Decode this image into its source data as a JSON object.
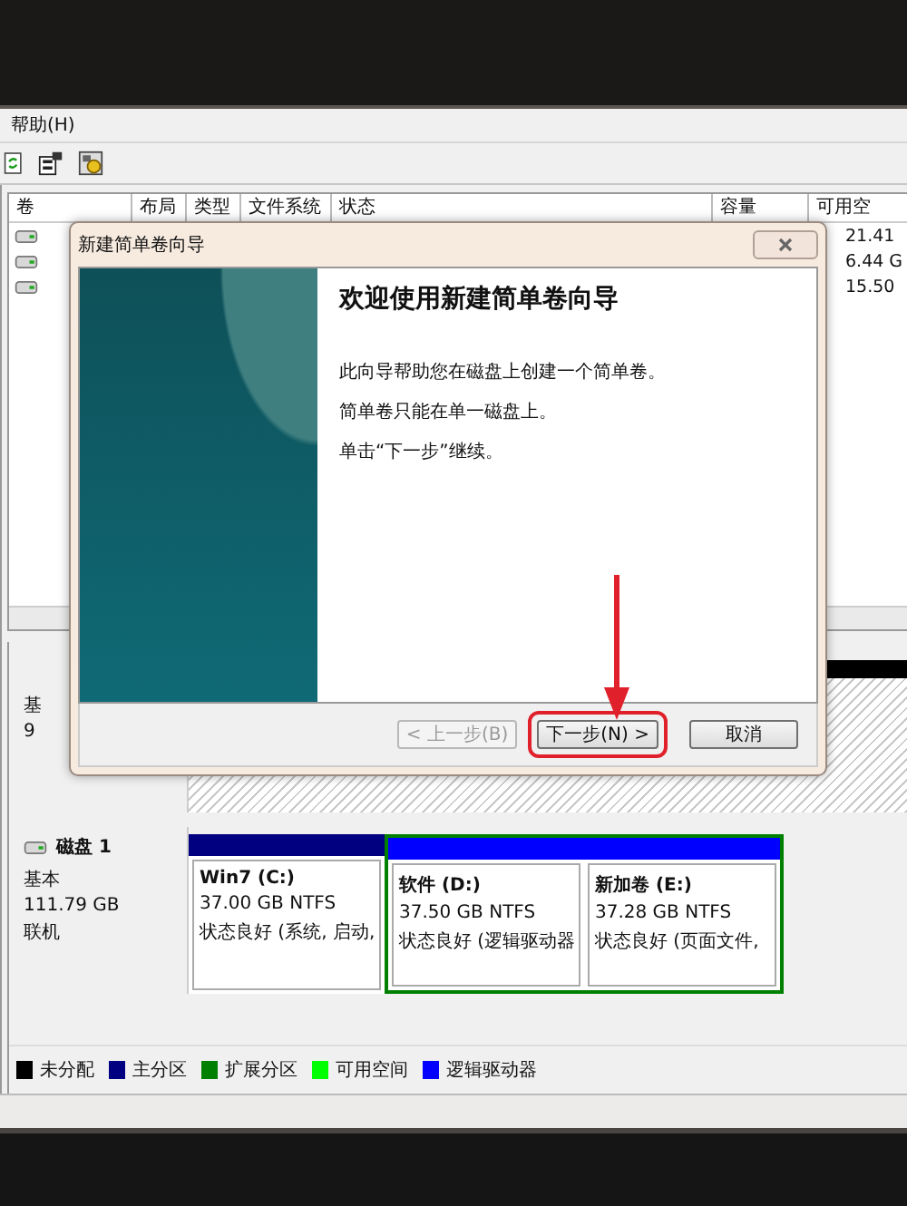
{
  "menu": [
    "帮助(H)"
  ],
  "volume_table": {
    "columns": [
      "卷",
      "布局",
      "类型",
      "文件系统",
      "状态",
      "容量",
      "可用空"
    ],
    "rows": [
      {
        "free": "21.41"
      },
      {
        "free": "6.44 G"
      },
      {
        "free": "15.50"
      }
    ]
  },
  "disk0": {
    "labels": [
      "基",
      "9"
    ]
  },
  "disk1": {
    "name": "磁盘 1",
    "type": "基本",
    "size": "111.79 GB",
    "status": "联机",
    "partitions": [
      {
        "kind": "primary",
        "color": "#000080",
        "name": "Win7  (C:)",
        "size": "37.00 GB NTFS",
        "status": "状态良好 (系统, 启动,"
      },
      {
        "kind": "extended",
        "color": "#008000",
        "children": [
          {
            "color": "#0000ff",
            "name": "软件  (D:)",
            "size": "37.50 GB NTFS",
            "status": "状态良好 (逻辑驱动器"
          },
          {
            "color": "#0000ff",
            "name": "新加卷  (E:)",
            "size": "37.28 GB NTFS",
            "status": "状态良好 (页面文件,"
          }
        ]
      }
    ]
  },
  "legend": [
    {
      "label": "未分配",
      "color": "#000000"
    },
    {
      "label": "主分区",
      "color": "#000080"
    },
    {
      "label": "扩展分区",
      "color": "#008000"
    },
    {
      "label": "可用空间",
      "color": "#00ff00"
    },
    {
      "label": "逻辑驱动器",
      "color": "#0000ff"
    }
  ],
  "dialog": {
    "title": "新建简单卷向导",
    "heading": "欢迎使用新建简单卷向导",
    "paragraphs": [
      "此向导帮助您在磁盘上创建一个简单卷。",
      "简单卷只能在单一磁盘上。",
      "单击“下一步”继续。"
    ],
    "buttons": [
      {
        "label": "< 上一步(B)",
        "disabled": true,
        "highlighted": false
      },
      {
        "label": "下一步(N) >",
        "disabled": false,
        "highlighted": true
      },
      {
        "label": "取消",
        "disabled": false,
        "highlighted": false
      }
    ]
  }
}
